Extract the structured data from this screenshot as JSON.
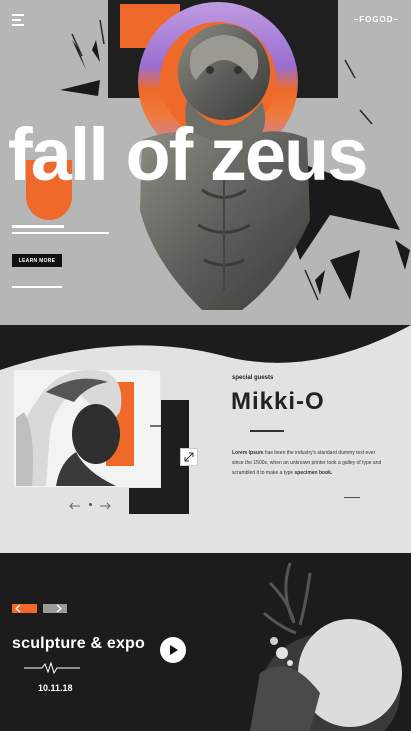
{
  "header": {
    "logo": "–FOGOD–",
    "menu_icon": "hamburger-menu-icon"
  },
  "hero": {
    "title": "fall of zeus",
    "cta_label": "LEARN MORE"
  },
  "guest": {
    "kicker": "special guests",
    "name": "Mikki-O",
    "description_bold_1": "Lorem Ipsum",
    "description_text": " has been the industry's standard dummy text ever since the 1500s, when an unknown printer took a galley of type and scrambled it to make a type ",
    "description_bold_2": "specimen book.",
    "prev_icon": "arrow-left-icon",
    "next_icon": "arrow-right-icon",
    "expand_icon": "expand-icon"
  },
  "event": {
    "title": "sculpture & expo",
    "date": "10.11.18",
    "play_icon": "play-icon"
  },
  "colors": {
    "accent": "#ef6a2a",
    "dark": "#1c1c1c",
    "light": "#e2e2e2",
    "hero_bg": "#b6b6b6"
  }
}
